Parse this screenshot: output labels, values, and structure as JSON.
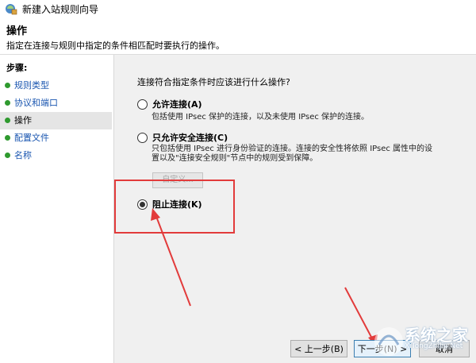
{
  "window": {
    "title": "新建入站规则向导"
  },
  "header": {
    "title": "操作",
    "description": "指定在连接与规则中指定的条件相匹配时要执行的操作。"
  },
  "sidebar": {
    "steps_label": "步骤:",
    "items": [
      {
        "label": "规则类型",
        "current": false
      },
      {
        "label": "协议和端口",
        "current": false
      },
      {
        "label": "操作",
        "current": true
      },
      {
        "label": "配置文件",
        "current": false
      },
      {
        "label": "名称",
        "current": false
      }
    ]
  },
  "main": {
    "question": "连接符合指定条件时应该进行什么操作?",
    "options": [
      {
        "label": "允许连接(A)",
        "desc": [
          "包括使用 IPsec 保护的连接，以及未使用 IPsec 保护的连接。"
        ],
        "checked": false
      },
      {
        "label": "只允许安全连接(C)",
        "desc": [
          "只包括使用 IPsec 进行身份验证的连接。连接的安全性将依照 IPsec 属性中的设",
          "置以及\"连接安全规则\"节点中的规则受到保障。"
        ],
        "checked": false
      },
      {
        "label": "阻止连接(K)",
        "desc": [],
        "checked": true
      }
    ],
    "customize_label": "自定义..."
  },
  "footer": {
    "back_label": "< 上一步(B)",
    "next_label": "下一步(N) >",
    "cancel_label": "取消"
  },
  "watermark": {
    "text": "系统之家",
    "url": "XiTongZhiJia.Net"
  },
  "colors": {
    "highlight": "#e23b3b",
    "step_link": "#1a56b0",
    "step_dot": "#2f9a2f"
  }
}
